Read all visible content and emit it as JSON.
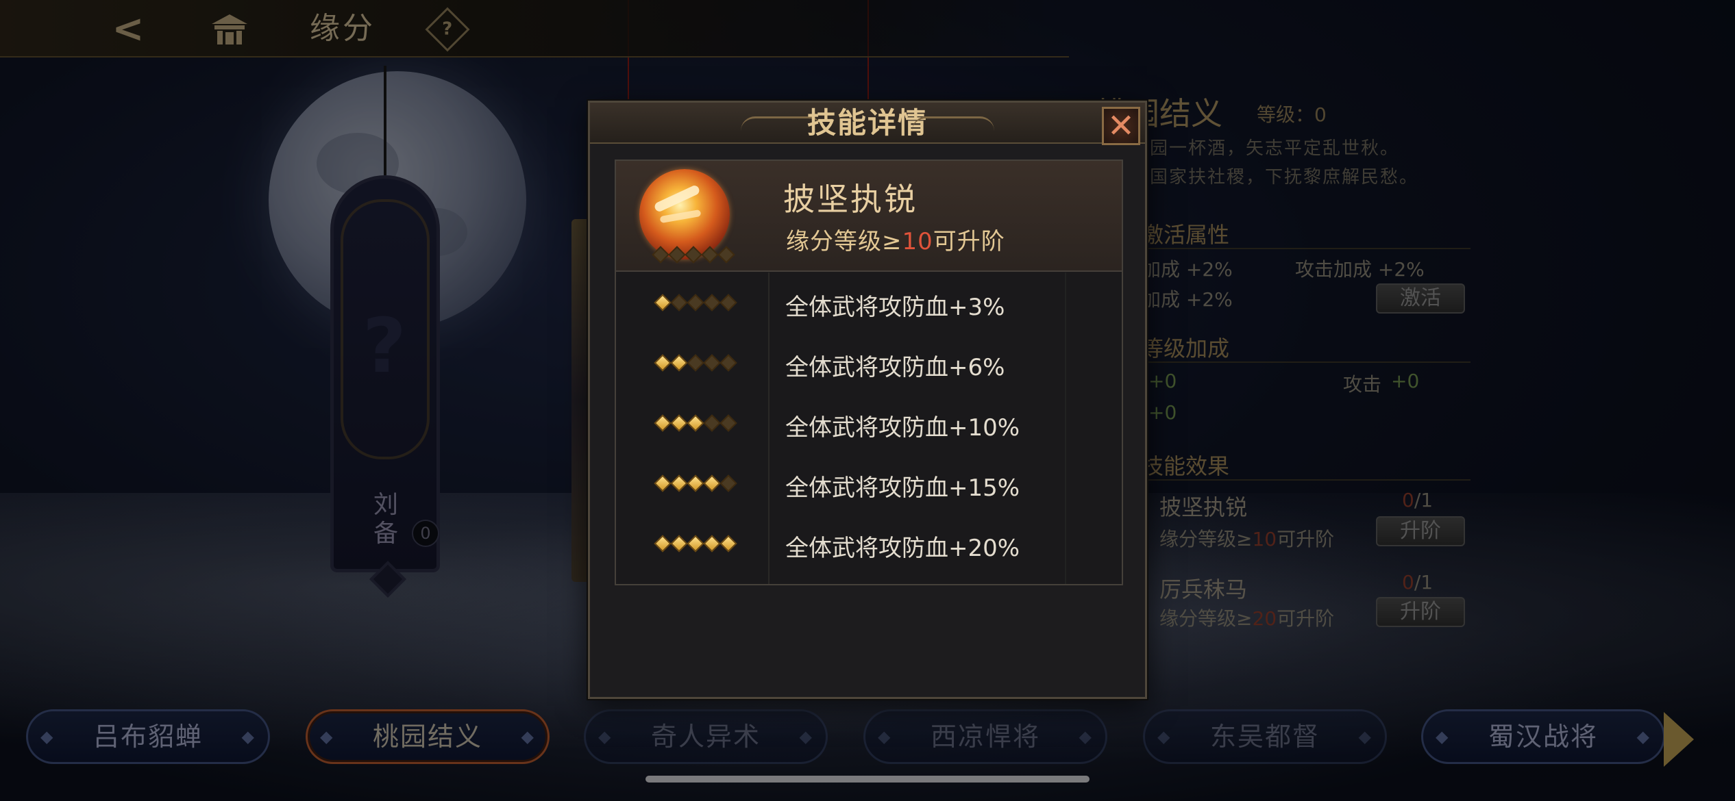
{
  "top_bar": {
    "title": "缘分",
    "icons": [
      "back-arrow-icon",
      "home-icon",
      "help-icon"
    ],
    "help_glyph": "?"
  },
  "character": {
    "name": "刘备",
    "name_chars": [
      "刘",
      "备"
    ],
    "badge": "0"
  },
  "right_panel": {
    "title": "桃园结义",
    "level_label": "等级：0",
    "desc_line1": "桃园一杯酒，矢志平定乱世秋。",
    "desc_line2": "报国家扶社稷，下抚黎庶解民愁。",
    "activate_section": "激活属性",
    "activate_attr1": "加成 +2%",
    "activate_attr2": "攻击加成 +2%",
    "activate_attr3": "加成 +2%",
    "activate_button": "激活",
    "level_bonus_section": "等级加成",
    "level_bonus_1": "+0",
    "level_bonus_2_label": "攻击",
    "level_bonus_2": "+0",
    "level_bonus_3": "+0",
    "skill_effect_section": "技能效果",
    "skill1_name": "披坚执锐",
    "skill1_count_cur": "0",
    "skill1_count_max": "/1",
    "skill1_req_pre": "缘分等级≥",
    "skill1_req_num": "10",
    "skill1_req_post": "可升阶",
    "skill1_button": "升阶",
    "skill2_name": "厉兵秣马",
    "skill2_count_cur": "0",
    "skill2_count_max": "/1",
    "skill2_req_pre": "缘分等级≥",
    "skill2_req_num": "20",
    "skill2_req_post": "可升阶",
    "skill2_button": "升阶"
  },
  "modal": {
    "title": "技能详情",
    "close_glyph": "✕",
    "skill_name": "披坚执锐",
    "skill_stars_on": 0,
    "requirement_pre": "缘分等级≥",
    "requirement_num": "10",
    "requirement_post": "可升阶",
    "tiers": [
      {
        "stars": 1,
        "text": "全体武将攻防血+3%"
      },
      {
        "stars": 2,
        "text": "全体武将攻防血+6%"
      },
      {
        "stars": 3,
        "text": "全体武将攻防血+10%"
      },
      {
        "stars": 4,
        "text": "全体武将攻防血+15%"
      },
      {
        "stars": 5,
        "text": "全体武将攻防血+20%"
      }
    ]
  },
  "tabs": [
    {
      "label": "吕布貂蝉",
      "state": "normal"
    },
    {
      "label": "桃园结义",
      "state": "active"
    },
    {
      "label": "奇人异术",
      "state": "dim"
    },
    {
      "label": "西凉悍将",
      "state": "dim"
    },
    {
      "label": "东吴都督",
      "state": "dim"
    },
    {
      "label": "蜀汉战将",
      "state": "normal"
    }
  ],
  "colors": {
    "accent_gold": "#e0c592",
    "highlight_red": "#e0533a",
    "tab_active_border": "#b3582e"
  }
}
